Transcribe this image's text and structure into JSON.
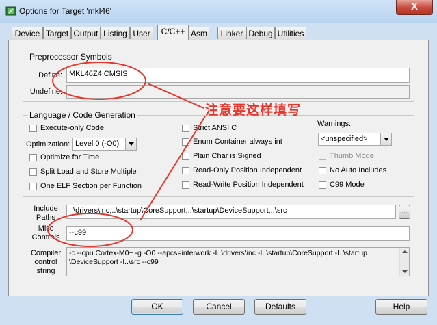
{
  "window": {
    "title": "Options for Target 'mkl46'",
    "close_glyph": "X"
  },
  "tabs": [
    {
      "label": "Device",
      "active": false
    },
    {
      "label": "Target",
      "active": false
    },
    {
      "label": "Output",
      "active": false
    },
    {
      "label": "Listing",
      "active": false
    },
    {
      "label": "User",
      "active": false
    },
    {
      "label": "C/C++",
      "active": true
    },
    {
      "label": "Asm",
      "active": false
    },
    {
      "label": "Linker",
      "active": false
    },
    {
      "label": "Debug",
      "active": false
    },
    {
      "label": "Utilities",
      "active": false
    }
  ],
  "preprocessor": {
    "group_title": "Preprocessor Symbols",
    "define_label": "Define:",
    "define_value": "MKL46Z4 CMSIS",
    "undefine_label": "Undefine:",
    "undefine_value": ""
  },
  "language": {
    "group_title": "Language / Code Generation",
    "execute_only": {
      "label": "Execute-only Code",
      "checked": false
    },
    "optimization_label": "Optimization:",
    "optimization_value": "Level 0 (-O0)",
    "optimize_time": {
      "label": "Optimize for Time",
      "checked": false
    },
    "split_load": {
      "label": "Split Load and Store Multiple",
      "checked": false
    },
    "one_elf": {
      "label": "One ELF Section per Function",
      "checked": false
    },
    "strict_ansi": {
      "label": "Strict ANSI C",
      "checked": false
    },
    "enum_container": {
      "label": "Enum Container always int",
      "checked": false
    },
    "plain_char": {
      "label": "Plain Char is Signed",
      "checked": false
    },
    "ropi": {
      "label": "Read-Only Position Independent",
      "checked": false
    },
    "rwpi": {
      "label": "Read-Write Position Independent",
      "checked": false
    },
    "warnings_label": "Warnings:",
    "warnings_value": "<unspecified>",
    "thumb_mode": {
      "label": "Thumb Mode",
      "checked": false,
      "disabled": true
    },
    "no_auto_includes": {
      "label": "No Auto Includes",
      "checked": false
    },
    "c99_mode": {
      "label": "C99 Mode",
      "checked": false
    }
  },
  "include": {
    "label_line1": "Include",
    "label_line2": "Paths",
    "value": "..\\drivers\\inc;..\\startup\\CoreSupport;..\\startup\\DeviceSupport;..\\src",
    "browse_label": "..."
  },
  "misc": {
    "label_line1": "Misc",
    "label_line2": "Controls",
    "value": "--c99"
  },
  "compiler": {
    "label_line1": "Compiler",
    "label_line2": "control",
    "label_line3": "string",
    "line1": "-c --cpu Cortex-M0+ -g -O0 --apcs=interwork -I..\\drivers\\inc -I..\\startup\\CoreSupport -I..\\startup",
    "line2": "\\DeviceSupport -I..\\src --c99"
  },
  "buttons": {
    "ok": "OK",
    "cancel": "Cancel",
    "defaults": "Defaults",
    "help": "Help"
  },
  "annotation": {
    "text": "注意要这样填写",
    "color": "#e8352b"
  }
}
